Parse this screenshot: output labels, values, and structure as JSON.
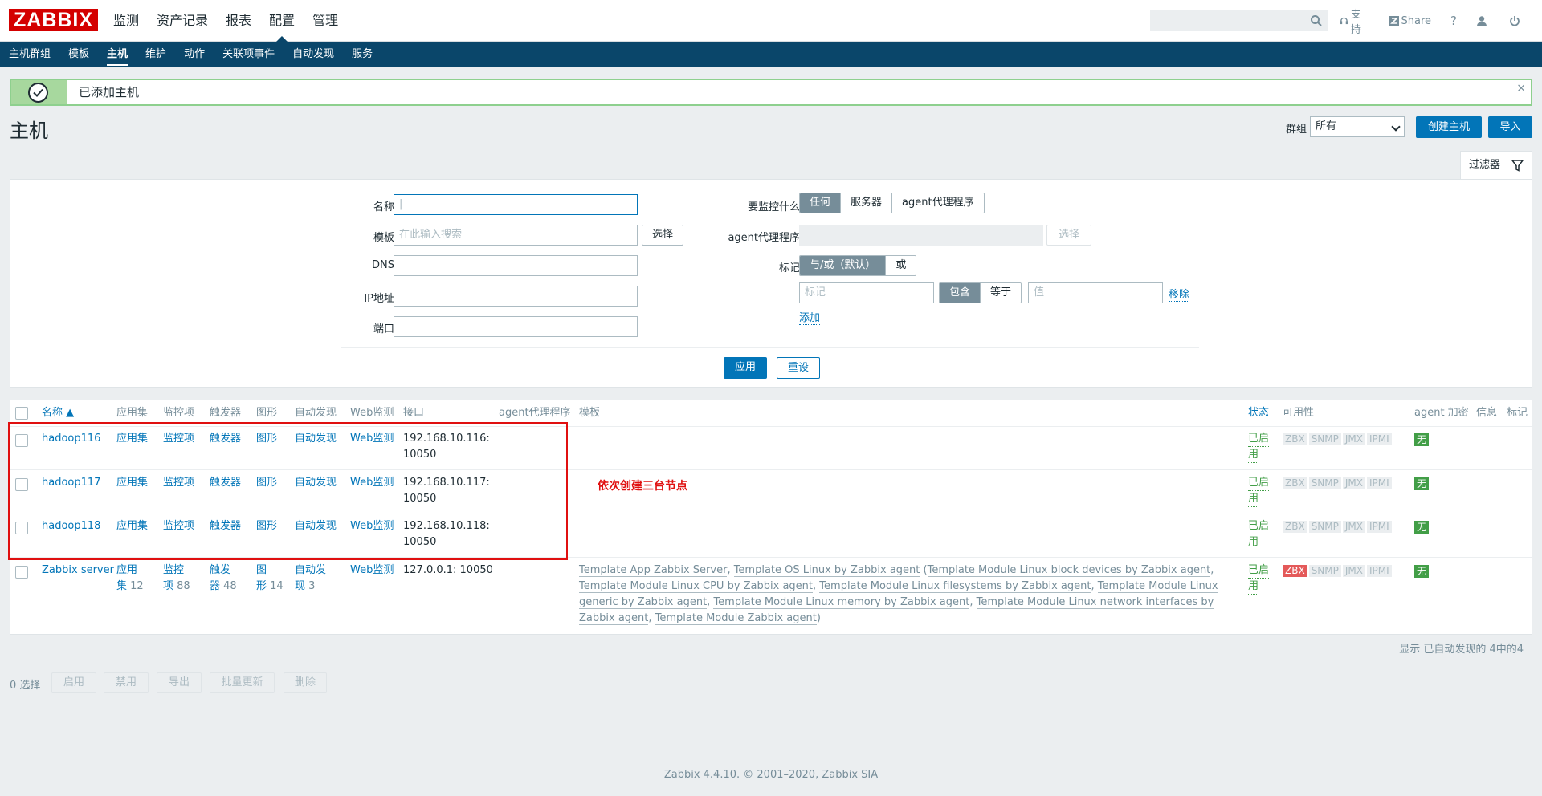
{
  "header": {
    "logo": "ZABBIX",
    "menu": [
      "监测",
      "资产记录",
      "报表",
      "配置",
      "管理"
    ],
    "active_menu": "配置",
    "search_placeholder": "",
    "support": "支持",
    "share": "Share",
    "help": "?"
  },
  "subnav": [
    "主机群组",
    "模板",
    "主机",
    "维护",
    "动作",
    "关联项事件",
    "自动发现",
    "服务"
  ],
  "message": {
    "text": "已添加主机",
    "close": "×"
  },
  "page": {
    "title": "主机",
    "group_label": "群组",
    "group_value": "所有",
    "create_button": "创建主机",
    "import_button": "导入",
    "filter_tab": "过滤器"
  },
  "filter": {
    "name_label": "名称",
    "template_label": "模板",
    "template_placeholder": "在此输入搜索",
    "template_select": "选择",
    "dns_label": "DNS",
    "ip_label": "IP地址",
    "port_label": "端口",
    "monitor_label": "要监控什么",
    "monitor_options": [
      "任何",
      "服务器",
      "agent代理程序"
    ],
    "proxy_label": "agent代理程序",
    "proxy_select": "选择",
    "tags_label": "标记",
    "tag_mode_options": [
      "与/或（默认）",
      "或"
    ],
    "tag_placeholder": "标记",
    "tag_op_options": [
      "包含",
      "等于"
    ],
    "value_placeholder": "值",
    "remove": "移除",
    "add": "添加",
    "apply": "应用",
    "reset": "重设"
  },
  "table": {
    "headers": {
      "name": "名称 ▲",
      "apps": "应用集",
      "items": "监控项",
      "triggers": "触发器",
      "graphs": "图形",
      "discovery": "自动发现",
      "web": "Web监测",
      "interface": "接口",
      "proxy": "agent代理程序",
      "templates": "模板",
      "status": "状态",
      "availability": "可用性",
      "encryption": "agent 加密",
      "info": "信息",
      "tags": "标记"
    },
    "rows": [
      {
        "name": "hadoop116",
        "apps": "应用集",
        "items": "监控项",
        "triggers": "触发器",
        "graphs": "图形",
        "discovery": "自动发现",
        "web": "Web监测",
        "iface1": "192.168.10.116:",
        "iface2": "10050",
        "status1": "已启",
        "status2": "用",
        "zbx": "ZBX",
        "snmp": "SNMP",
        "jmx": "JMX",
        "ipmi": "IPMI",
        "enc": "无"
      },
      {
        "name": "hadoop117",
        "apps": "应用集",
        "items": "监控项",
        "triggers": "触发器",
        "graphs": "图形",
        "discovery": "自动发现",
        "web": "Web监测",
        "iface1": "192.168.10.117:",
        "iface2": "10050",
        "status1": "已启",
        "status2": "用",
        "zbx": "ZBX",
        "snmp": "SNMP",
        "jmx": "JMX",
        "ipmi": "IPMI",
        "enc": "无"
      },
      {
        "name": "hadoop118",
        "apps": "应用集",
        "items": "监控项",
        "triggers": "触发器",
        "graphs": "图形",
        "discovery": "自动发现",
        "web": "Web监测",
        "iface1": "192.168.10.118:",
        "iface2": "10050",
        "status1": "已启",
        "status2": "用",
        "zbx": "ZBX",
        "snmp": "SNMP",
        "jmx": "JMX",
        "ipmi": "IPMI",
        "enc": "无"
      }
    ],
    "server_row": {
      "name": "Zabbix server",
      "apps1": "应用",
      "apps2": "集",
      "apps_count": "12",
      "items1": "监控",
      "items2": "项",
      "items_count": "88",
      "triggers1": "触发",
      "triggers2": "器",
      "triggers_count": "48",
      "graphs1": "图",
      "graphs2": "形",
      "graphs_count": "14",
      "discovery1": "自动发",
      "discovery2": "现",
      "discovery_count": "3",
      "web": "Web监测",
      "iface": "127.0.0.1: 10050",
      "templates": {
        "t1": "Template App Zabbix Server",
        "sep1": ", ",
        "t2": "Template OS Linux by Zabbix agent",
        "open": " (",
        "t3": "Template Module Linux block devices by Zabbix agent",
        "sep2": ", ",
        "t4": "Template Module Linux CPU by Zabbix agent",
        "sep3": ", ",
        "t5": "Template Module Linux filesystems by Zabbix agent",
        "sep4": ", ",
        "t6": "Template Module Linux generic by Zabbix agent",
        "sep5": ", ",
        "t7": "Template Module Linux memory by Zabbix agent",
        "sep6": ", ",
        "t8": "Template Module Linux network interfaces by Zabbix agent",
        "sep7": ", ",
        "t9": "Template Module Zabbix agent",
        "close": ")"
      },
      "status1": "已启",
      "status2": "用",
      "zbx": "ZBX",
      "snmp": "SNMP",
      "jmx": "JMX",
      "ipmi": "IPMI",
      "enc": "无"
    },
    "footer": "显示 已自动发现的 4中的4"
  },
  "annotation": "依次创建三台节点",
  "actions": {
    "selected": "0 选择",
    "buttons": [
      "启用",
      "禁用",
      "导出",
      "批量更新",
      "删除"
    ]
  },
  "copyright": "Zabbix 4.4.10. © 2001–2020, Zabbix SIA",
  "colors": {
    "brand": "#d40000",
    "nav": "#0a466a",
    "link": "#0275b8",
    "ok": "#429e47",
    "error": "#e45959"
  }
}
